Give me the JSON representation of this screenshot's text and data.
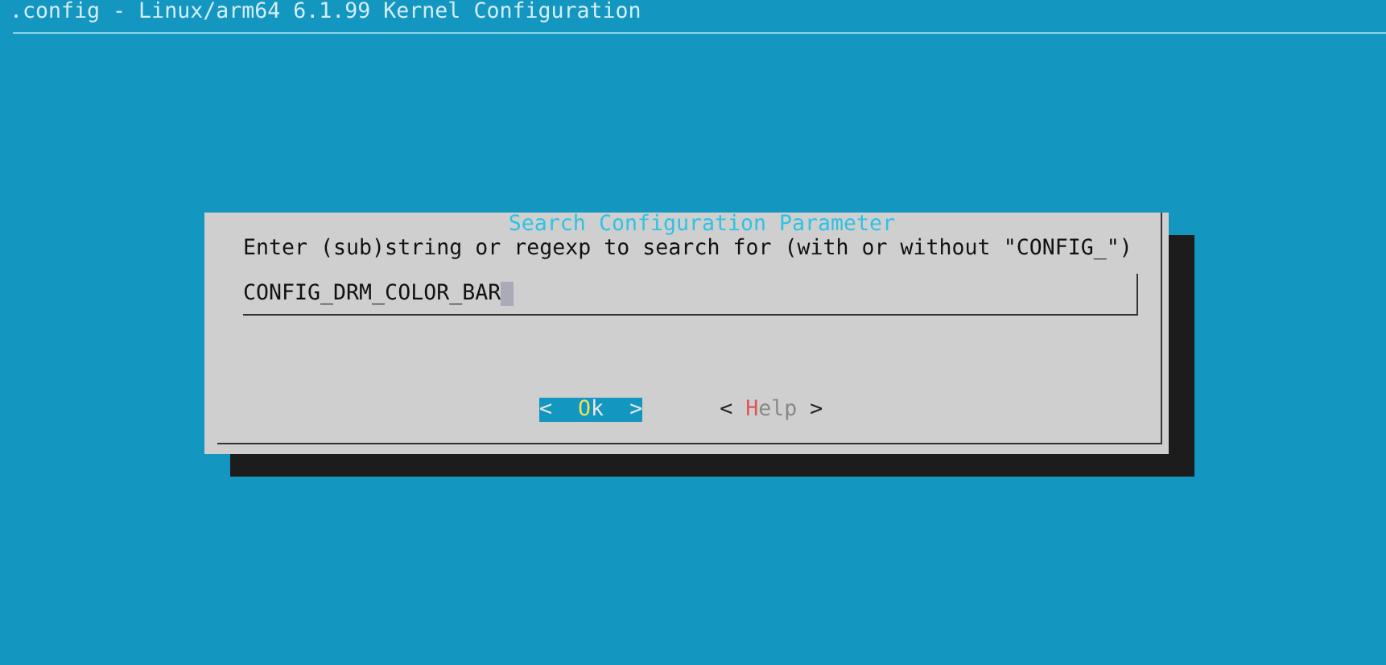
{
  "window": {
    "title": ".config - Linux/arm64 6.1.99 Kernel Configuration"
  },
  "dialog": {
    "title": "Search Configuration Parameter",
    "prompt": "Enter (sub)string or regexp to search for (with or without \"CONFIG_\")",
    "input": {
      "value": "CONFIG_DRM_COLOR_BAR"
    },
    "buttons": [
      {
        "open": "<",
        "label": "Ok",
        "close": ">",
        "selected": true
      },
      {
        "open": "<",
        "label": "Help",
        "close": ">",
        "selected": false
      }
    ]
  }
}
